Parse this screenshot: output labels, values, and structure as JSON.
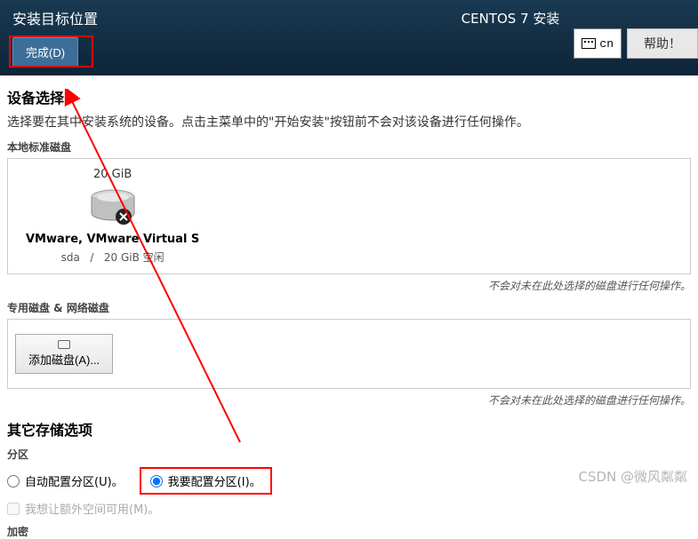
{
  "header": {
    "title": "安装目标位置",
    "done_label": "完成(D)",
    "distro": "CENTOS 7 安装",
    "lang_code": "cn",
    "help_label": "帮助！"
  },
  "device": {
    "section_title": "设备选择",
    "section_desc": "选择要在其中安装系统的设备。点击主菜单中的\"开始安装\"按钮前不会对该设备进行任何操作。",
    "local_title": "本地标准磁盘",
    "disk": {
      "size_top": "20 GiB",
      "name": "VMware, VMware Virtual S",
      "dev": "sda",
      "sep": "/",
      "free": "20 GiB 空闲"
    },
    "note": "不会对未在此处选择的磁盘进行任何操作。",
    "special_title": "专用磁盘 & 网络磁盘",
    "add_disk_label": "添加磁盘(A)...",
    "note2": "不会对未在此处选择的磁盘进行任何操作。"
  },
  "storage": {
    "section_title": "其它存储选项",
    "partition_label": "分区",
    "auto_label": "自动配置分区(U)。",
    "manual_label": "我要配置分区(I)。",
    "extra_space_label": "我想让额外空间可用(M)。",
    "encrypt_label": "加密"
  },
  "watermark": "CSDN @微风粼粼"
}
